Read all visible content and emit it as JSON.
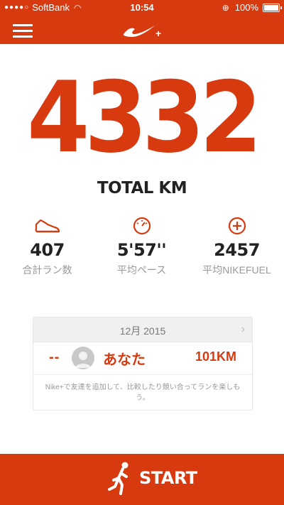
{
  "status": {
    "carrier": "SoftBank",
    "time": "10:54",
    "battery": "100%"
  },
  "nav": {
    "logo_plus": "+"
  },
  "summary": {
    "total": "4332",
    "total_label": "TOTAL KM"
  },
  "stats": [
    {
      "icon": "shoe-icon",
      "value": "407",
      "label": "合計ラン数"
    },
    {
      "icon": "stopwatch-icon",
      "value": "5'57''",
      "label": "平均ペース"
    },
    {
      "icon": "fuel-icon",
      "value": "2457",
      "label": "平均NIKEFUEL"
    }
  ],
  "leaderboard": {
    "month": "12月 2015",
    "row": {
      "rank": "--",
      "name": "あなた",
      "distance": "101KM"
    },
    "note": "Nike+で友達を追加して、比較したり競い合ってランを楽しもう。"
  },
  "start": {
    "label": "START"
  },
  "colors": {
    "accent": "#d83a10",
    "text": "#222222",
    "muted": "#999999"
  }
}
